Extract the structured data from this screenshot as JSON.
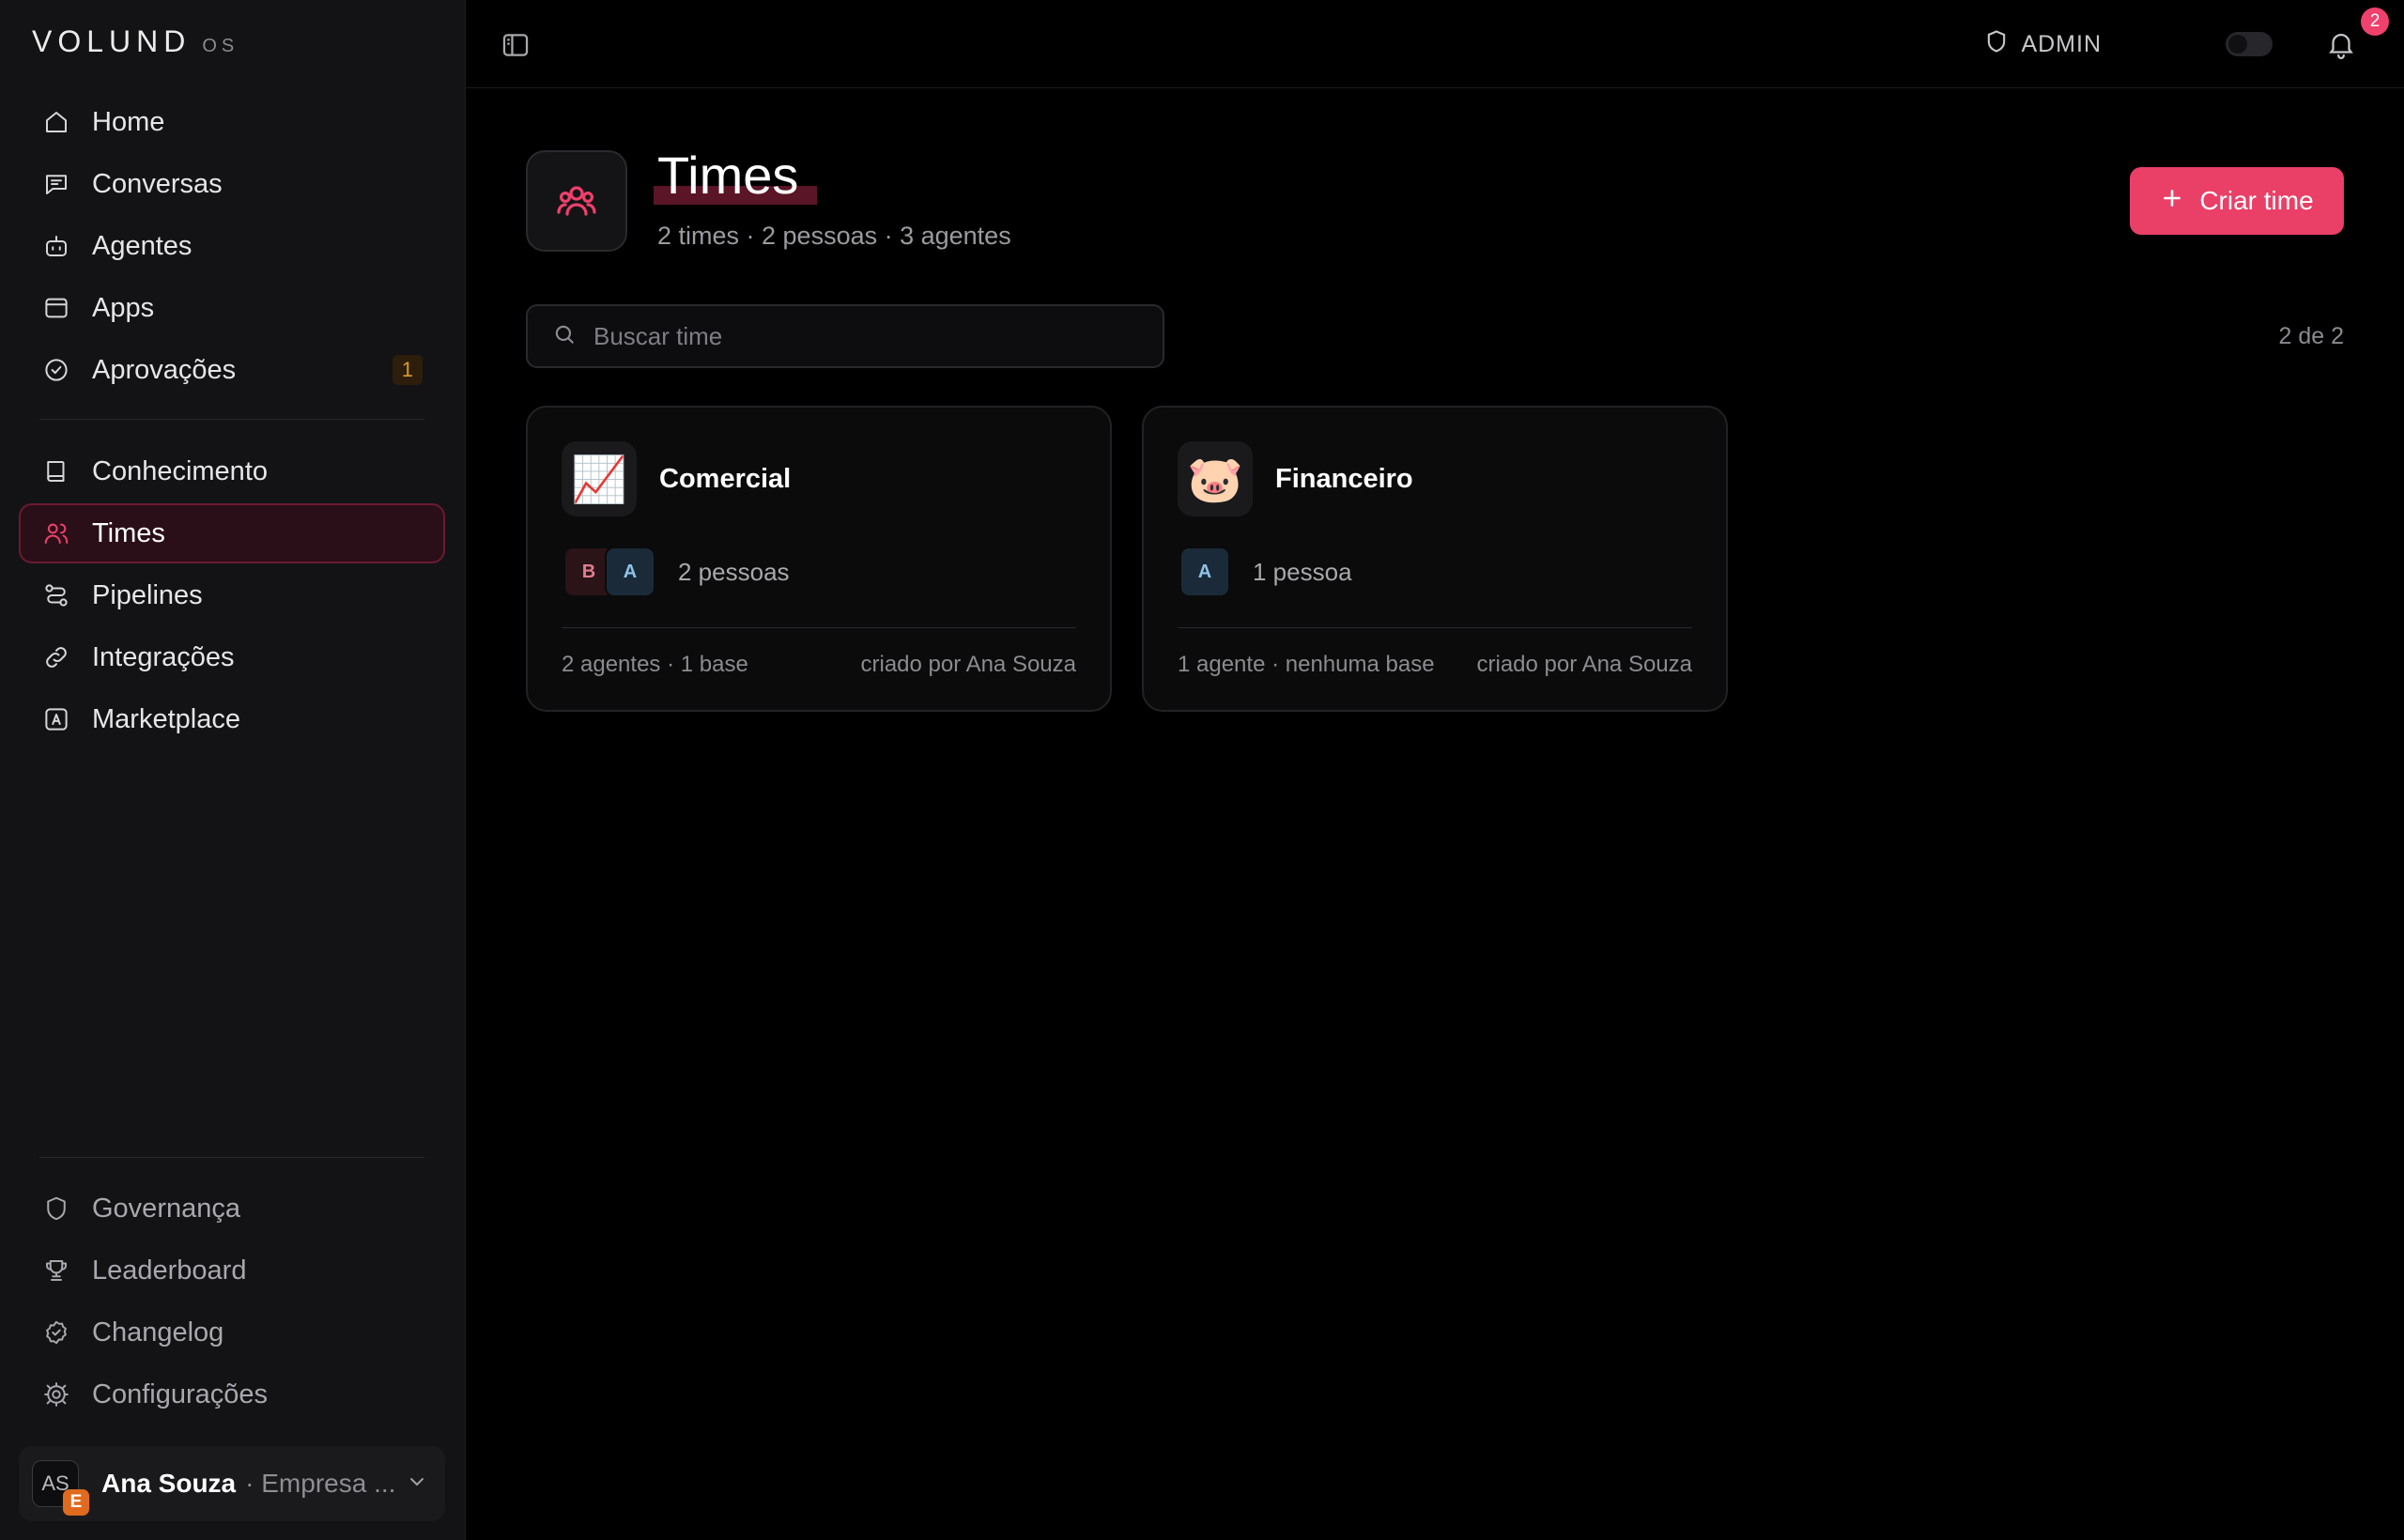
{
  "brand": {
    "name": "VOLUND",
    "suffix": "OS"
  },
  "sidebar": {
    "primary": [
      {
        "label": "Home",
        "icon": "home-icon"
      },
      {
        "label": "Conversas",
        "icon": "chat-icon"
      },
      {
        "label": "Agentes",
        "icon": "bot-icon"
      },
      {
        "label": "Apps",
        "icon": "app-window-icon"
      },
      {
        "label": "Aprovações",
        "icon": "check-circle-icon",
        "badge": "1"
      }
    ],
    "secondary": [
      {
        "label": "Conhecimento",
        "icon": "book-icon"
      },
      {
        "label": "Times",
        "icon": "users-icon",
        "active": true
      },
      {
        "label": "Pipelines",
        "icon": "pipeline-icon"
      },
      {
        "label": "Integrações",
        "icon": "link-icon"
      },
      {
        "label": "Marketplace",
        "icon": "store-icon"
      }
    ],
    "bottom": [
      {
        "label": "Governança",
        "icon": "shield-icon"
      },
      {
        "label": "Leaderboard",
        "icon": "trophy-icon"
      },
      {
        "label": "Changelog",
        "icon": "badge-check-icon"
      },
      {
        "label": "Configurações",
        "icon": "gear-icon"
      }
    ],
    "user": {
      "initials": "AS",
      "badge": "E",
      "name": "Ana Souza",
      "org": "· Empresa ..."
    }
  },
  "topbar": {
    "role": "ADMIN",
    "notifications": "2"
  },
  "page": {
    "title": "Times",
    "subtitle": "2 times · 2 pessoas · 3 agentes",
    "create_label": "Criar time",
    "search_placeholder": "Buscar time",
    "count": "2 de 2"
  },
  "teams": [
    {
      "name": "Comercial",
      "emoji": "📈",
      "members": [
        "B",
        "A"
      ],
      "people": "2 pessoas",
      "meta": "2 agentes · 1 base",
      "creator": "criado por Ana Souza"
    },
    {
      "name": "Financeiro",
      "emoji": "🐷",
      "members": [
        "A"
      ],
      "people": "1 pessoa",
      "meta": "1 agente · nenhuma base",
      "creator": "criado por Ana Souza"
    }
  ],
  "colors": {
    "accent": "#ea3f67",
    "sidebar_bg": "#131315",
    "approval_badge": "#d99a2b"
  }
}
